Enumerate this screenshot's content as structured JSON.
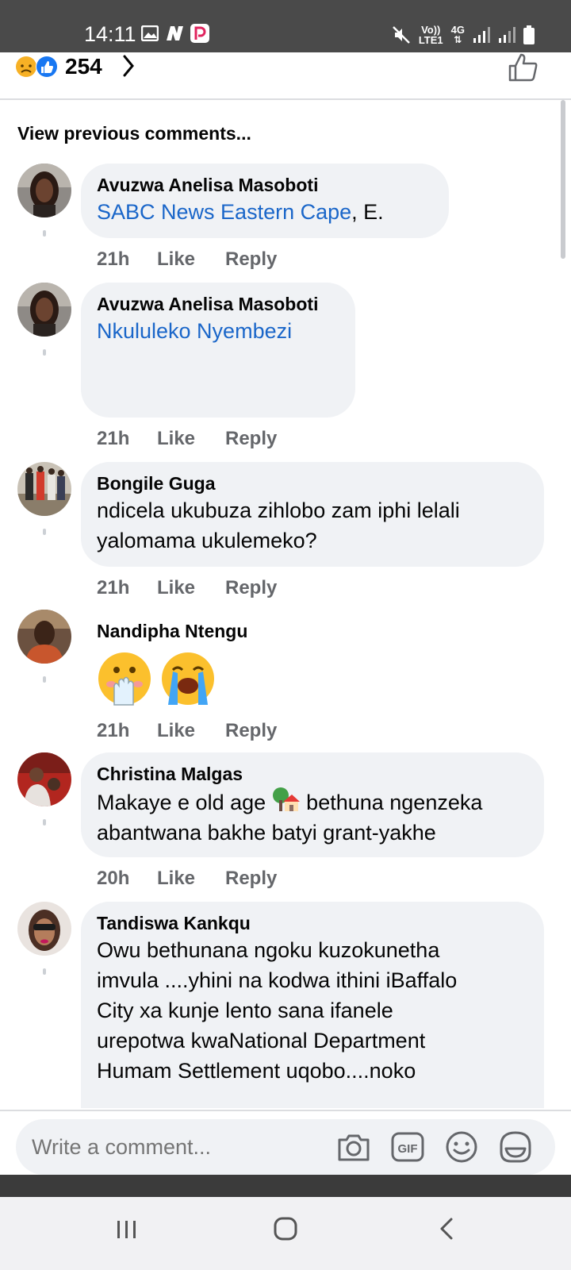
{
  "status": {
    "time": "14:11",
    "volte": "Vo))",
    "lte": "LTE1",
    "network": "4G"
  },
  "reactions": {
    "count": "254",
    "icons": [
      "sad-reaction-icon",
      "like-reaction-icon"
    ]
  },
  "view_previous": "View previous comments...",
  "comments": [
    {
      "author": "Avuzwa Anelisa Masoboti",
      "mention": "SABC News Eastern Cape",
      "text_after": ", E.",
      "time": "21h",
      "like": "Like",
      "reply": "Reply"
    },
    {
      "author": "Avuzwa Anelisa Masoboti",
      "mention": "Nkululeko Nyembezi",
      "time": "21h",
      "like": "Like",
      "reply": "Reply"
    },
    {
      "author": "Bongile Guga",
      "line1": "ndicela ukubuza zihlobo zam iphi lelali",
      "line2": "yalomama ukulemeko?",
      "time": "21h",
      "like": "Like",
      "reply": "Reply"
    },
    {
      "author": "Nandipha Ntengu",
      "emojis": [
        "hand-over-mouth-emoji",
        "crying-face-emoji"
      ],
      "time": "21h",
      "like": "Like",
      "reply": "Reply"
    },
    {
      "author": "Christina Malgas",
      "line1_a": "Makaye e old age",
      "line1_b": "bethuna ngenzeka",
      "line2": "abantwana bakhe batyi grant-yakhe",
      "time": "20h",
      "like": "Like",
      "reply": "Reply"
    },
    {
      "author": "Tandiswa Kankqu",
      "line1": "Owu bethunana ngoku kuzokunetha",
      "line2": "imvula ....yhini na kodwa ithini iBaffalo",
      "line3": "City xa kunje lento sana ifanele",
      "line4": "urepotwa kwaNational Department",
      "line5": "Humam Settlement uqobo....noko"
    }
  ],
  "compose": {
    "placeholder": "Write a comment...",
    "icons": [
      "camera-icon",
      "gif-icon",
      "emoji-icon",
      "sticker-icon"
    ]
  },
  "colors": {
    "mention": "#1a66c9",
    "bubble": "#f0f2f5",
    "meta": "#65676b",
    "status_bar": "#4a4a4a"
  }
}
